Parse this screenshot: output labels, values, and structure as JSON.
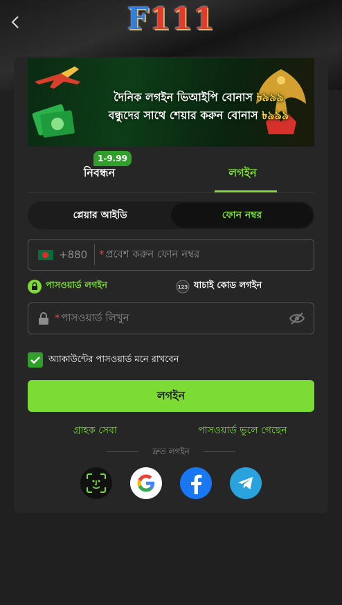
{
  "header": {
    "logo_f": "F",
    "logo_num": "111"
  },
  "banner": {
    "line1": "দৈনিক লগইন ভিআইপি বোনাস ",
    "line1_amount": "৳৯৯৯",
    "line2": "বন্ধুদের সাথে শেয়ার করুন বোনাস ",
    "line2_amount": "৳৯৯৯"
  },
  "tabs": {
    "register_label": "নিবন্ধন",
    "register_badge": "1-9.99",
    "login_label": "লগইন"
  },
  "segment": {
    "player_id": "প্লেয়ার আইডি",
    "phone_number": "ফোন নম্বর"
  },
  "phone_field": {
    "country_code": "+880",
    "required_mark": "*",
    "placeholder": "প্রবেশ করুন ফোন নম্বর"
  },
  "login_methods": {
    "password_login": "পাসওয়ার্ড লগইন",
    "otp_login": "যাচাই কোড লগইন"
  },
  "password_field": {
    "required_mark": "*",
    "placeholder": "পাসওয়ার্ড লিখুন"
  },
  "remember": {
    "label": "অ্যাকাউন্টের পাসওয়ার্ড মনে রাখবেন",
    "checked": true
  },
  "login_button": "লগইন",
  "links": {
    "customer_service": "গ্রাহক সেবা",
    "forgot_password": "পাসওয়ার্ড ভুলে গেছেন"
  },
  "quick_login": {
    "label": "দ্রুত লগইন",
    "providers": [
      "face-id-icon",
      "google-icon",
      "facebook-icon",
      "telegram-icon"
    ]
  },
  "colors": {
    "accent": "#7ddc34",
    "background": "#202020",
    "card": "#262626"
  }
}
